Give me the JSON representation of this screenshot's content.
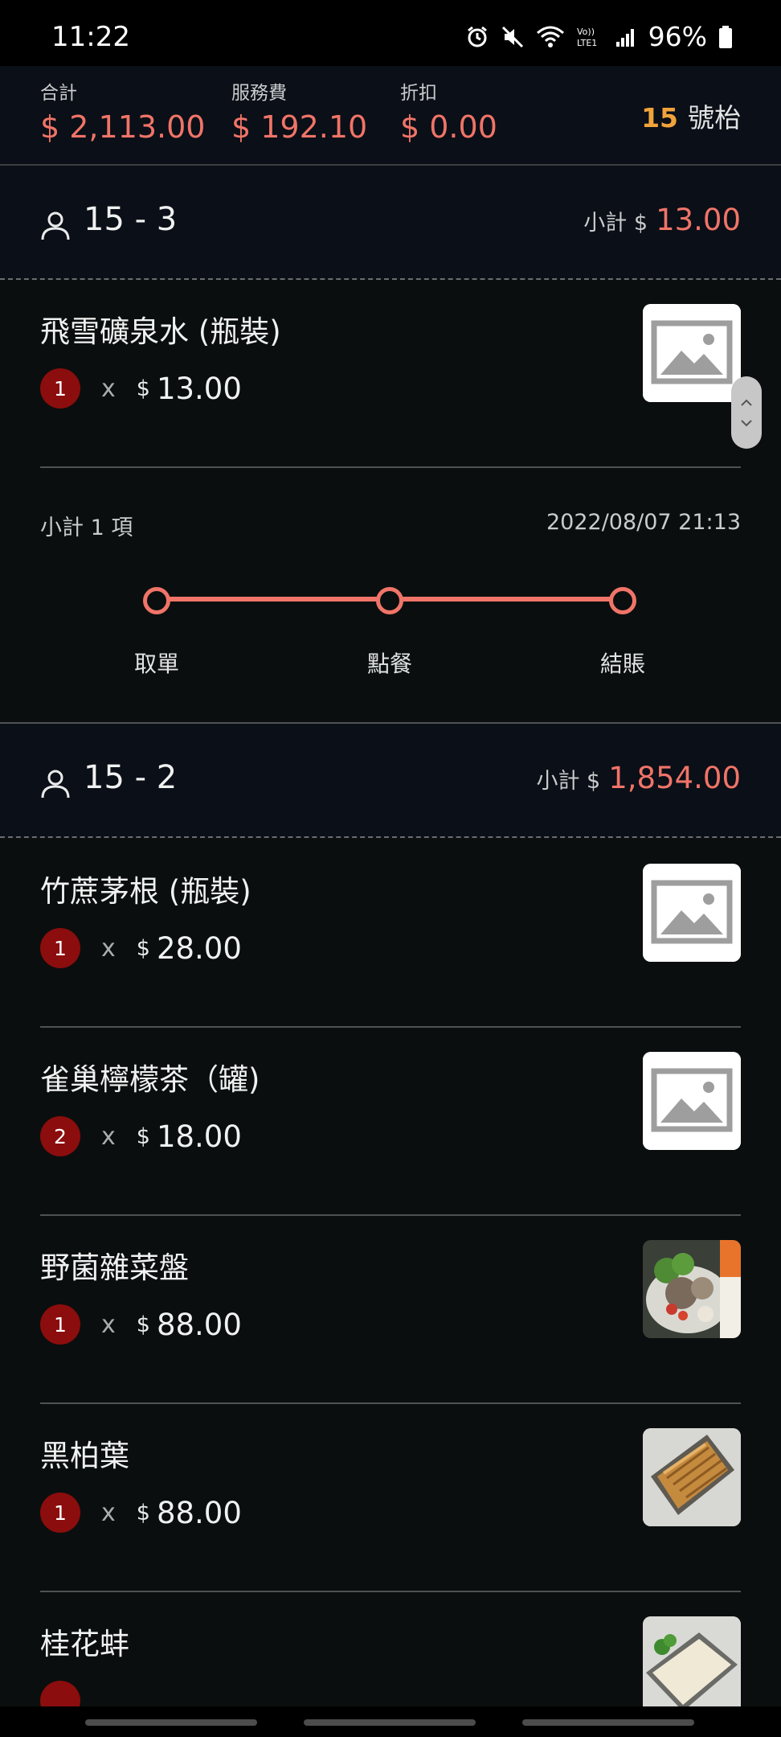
{
  "status_bar": {
    "time": "11:22",
    "battery": "96%",
    "icons": [
      "alarm-icon",
      "mute-icon",
      "wifi-icon",
      "volte-icon",
      "signal-icon",
      "battery-icon"
    ]
  },
  "totals": {
    "total_label": "合計",
    "total_value": "$ 2,113.00",
    "service_label": "服務費",
    "service_value": "$ 192.10",
    "discount_label": "折扣",
    "discount_value": "$ 0.00",
    "table_number": "15",
    "table_suffix": "號枱"
  },
  "groups": [
    {
      "title": "15 - 3",
      "subtotal_label": "小計 $",
      "subtotal_amount": "13.00",
      "items": [
        {
          "name": "飛雪礦泉水 (瓶裝)",
          "qty": "1",
          "x": "x",
          "currency": "$",
          "price": "13.00",
          "image": "placeholder-image-icon"
        }
      ],
      "summary": {
        "count": "小計 1 項",
        "datetime": "2022/08/07 21:13",
        "steps": [
          "取單",
          "點餐",
          "結賬"
        ]
      }
    },
    {
      "title": "15 - 2",
      "subtotal_label": "小計 $",
      "subtotal_amount": "1,854.00",
      "items": [
        {
          "name": "竹蔗茅根 (瓶裝)",
          "qty": "1",
          "x": "x",
          "currency": "$",
          "price": "28.00",
          "image": "placeholder-image-icon"
        },
        {
          "name": "雀巢檸檬茶（罐)",
          "qty": "2",
          "x": "x",
          "currency": "$",
          "price": "18.00",
          "image": "placeholder-image-icon"
        },
        {
          "name": "野菌雜菜盤",
          "qty": "1",
          "x": "x",
          "currency": "$",
          "price": "88.00",
          "image": "vegetable-platter-photo"
        },
        {
          "name": "黑柏葉",
          "qty": "1",
          "x": "x",
          "currency": "$",
          "price": "88.00",
          "image": "tripe-platter-photo"
        },
        {
          "name": "桂花蚌",
          "qty": "",
          "x": "",
          "currency": "",
          "price": "",
          "image": "clam-platter-photo"
        }
      ]
    }
  ],
  "colors": {
    "accent": "#f07468",
    "table_number": "#f1a33b",
    "badge": "#8b0d0d",
    "header_bg": "#0b0f17",
    "page_bg": "#0b0e0e"
  }
}
